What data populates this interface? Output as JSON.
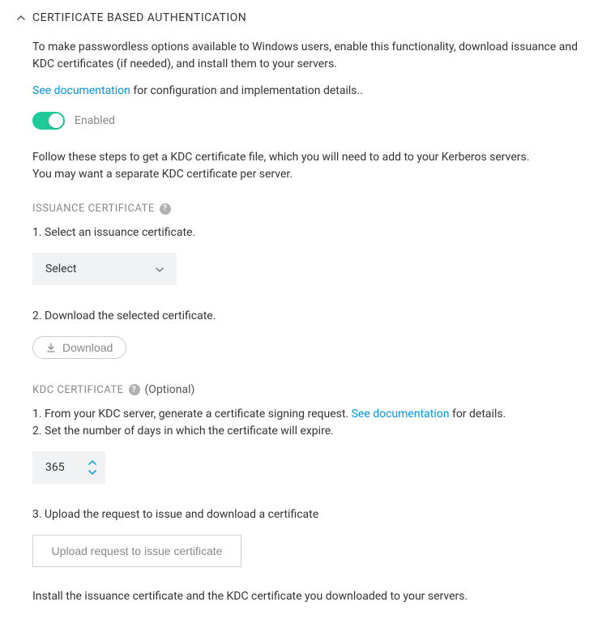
{
  "header": {
    "title": "CERTIFICATE BASED AUTHENTICATION"
  },
  "intro": {
    "description": "To make passwordless options available to Windows users, enable this functionality, download issuance and KDC certificates (if needed), and install them to your servers.",
    "doc_link": "See documentation",
    "doc_suffix": " for configuration and implementation details.."
  },
  "toggle": {
    "label": "Enabled"
  },
  "steps_intro": {
    "line1": "Follow these steps to get a KDC certificate file, which you will need to add to your Kerberos servers.",
    "line2": "You may want a separate KDC certificate per server."
  },
  "issuance": {
    "title": "ISSUANCE CERTIFICATE",
    "step1": "1. Select an issuance certificate.",
    "select_label": "Select",
    "step2": "2. Download the selected certificate.",
    "download_label": "Download"
  },
  "kdc": {
    "title": "KDC CERTIFICATE",
    "optional": "(Optional)",
    "step1_prefix": "1. From your KDC server, generate a certificate signing request. ",
    "step1_link": "See documentation",
    "step1_suffix": " for details.",
    "step2": "2. Set the number of days in which the certificate will expire.",
    "days_value": "365",
    "step3": "3. Upload the request to issue and download a certificate",
    "upload_label": "Upload request to issue certificate"
  },
  "footer": {
    "install_text": "Install the issuance certificate and the KDC certificate you downloaded to your servers."
  }
}
